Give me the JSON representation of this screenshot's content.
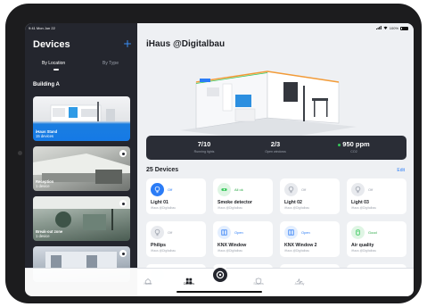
{
  "status_bar": {
    "time": "9:41 Mon Jun 22",
    "battery": "100%"
  },
  "sidebar": {
    "title": "Devices",
    "add_icon": "plus-icon",
    "tabs": [
      {
        "label": "By Location",
        "active": true
      },
      {
        "label": "By Type",
        "active": false
      }
    ],
    "section": "Building A",
    "rooms": [
      {
        "name": "iHaus Stand",
        "count": "15 devices",
        "selected": true
      },
      {
        "name": "Reception",
        "count": "1 device",
        "selected": false
      },
      {
        "name": "Break-out zone",
        "count": "1 device",
        "selected": false
      },
      {
        "name": "",
        "count": "",
        "selected": false
      }
    ]
  },
  "main": {
    "title": "iHaus @Digitalbau",
    "stats": [
      {
        "value": "7/10",
        "label": "Running lights"
      },
      {
        "value": "2/3",
        "label": "Open windows"
      },
      {
        "value": "950 ppm",
        "label": "CO2"
      }
    ],
    "devices_heading": "25 Devices",
    "edit_label": "Edit",
    "devices": [
      {
        "name": "Light 01",
        "status": "Off",
        "location": "iHaus @Digitalbau",
        "icon": "bulb-icon",
        "tone": "blue"
      },
      {
        "name": "Smoke detector",
        "status": "All ok",
        "location": "iHaus @Digitalbau",
        "icon": "smoke-detector-icon",
        "tone": "green"
      },
      {
        "name": "Light 02",
        "status": "Off",
        "location": "iHaus @Digitalbau",
        "icon": "bulb-icon",
        "tone": "grey"
      },
      {
        "name": "Light 03",
        "status": "Off",
        "location": "iHaus @Digitalbau",
        "icon": "bulb-icon",
        "tone": "grey"
      },
      {
        "name": "Philips",
        "status": "Off",
        "location": "iHaus @Digitalbau",
        "icon": "bulb-icon",
        "tone": "grey"
      },
      {
        "name": "KNX Window",
        "status": "Open",
        "location": "iHaus @Digitalbau",
        "icon": "window-icon",
        "tone": "blue"
      },
      {
        "name": "KNX Window 2",
        "status": "Open",
        "location": "iHaus @Digitalbau",
        "icon": "window-icon",
        "tone": "blue"
      },
      {
        "name": "Air quality",
        "status": "Good",
        "location": "iHaus @Digitalbau",
        "icon": "air-quality-icon",
        "tone": "green"
      }
    ]
  },
  "tab_bar": {
    "items": [
      {
        "label": "Home",
        "icon": "home-icon",
        "active": false
      },
      {
        "label": "Devices",
        "icon": "grid-icon",
        "active": true
      },
      {
        "label": "Scenes",
        "icon": "shield-icon",
        "active": false
      },
      {
        "label": "Activity",
        "icon": "activity-icon",
        "active": false
      }
    ],
    "center_icon": "ihaus-logo-icon"
  },
  "colors": {
    "accent": "#2b7cf6",
    "sidebar_bg": "#24262e",
    "stats_bg": "#2a2d36",
    "good": "#35c759"
  }
}
